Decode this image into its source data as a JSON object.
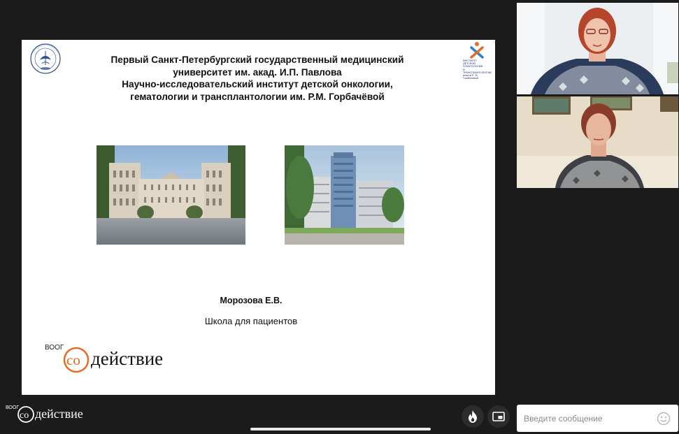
{
  "slide": {
    "title_lines": [
      "Первый Санкт-Петербургский государственный медицинский",
      "университет им. акад. И.П. Павлова",
      "Научно-исследовательский институт детской онкологии,",
      "гематологии и трансплантологии им. Р.М. Горбачёвой"
    ],
    "left_logo_text": "MEDICINA ARS NOBILISSIMA",
    "left_logo_year": "1897",
    "right_logo_caption": [
      "ИНСТИТУТ",
      "ДЕТСКОЙ ГЕМАТОЛОГИИ",
      "И ТРАНСПЛАНТОЛОГИИ",
      "имени Р. М. Горбачёвой"
    ],
    "author": "Морозова Е.В.",
    "school": "Школа для пациентов",
    "sponsor_prefix": "ВООГ",
    "sponsor_name": "действие",
    "sponsor_co": "со"
  },
  "bottom_bar": {
    "brand_prefix": "ВООГ",
    "brand_co": "со",
    "brand_name": "действие",
    "fire_icon": "fire-icon",
    "pip_icon": "picture-in-picture-icon"
  },
  "chat": {
    "placeholder": "Введите сообщение",
    "emoji_icon": "smiley-icon"
  },
  "colors": {
    "background": "#1b1b1b",
    "sodeystvie_orange": "#ea6a1f"
  }
}
